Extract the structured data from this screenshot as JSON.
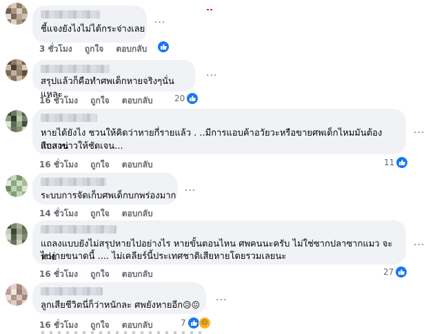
{
  "comments": [
    {
      "text": "ชี้แจงยังไงไม่ได้กระจ่างเลย",
      "time": "3 ชั่วโมง",
      "like": "ถูกใจ",
      "reply": "ตอบกลับ",
      "reaction_count": ""
    },
    {
      "text": "สรุปแล้วก็คือทำศพเด็กหายจริงๆนั่นแหละ",
      "time": "16 ชั่วโมง",
      "like": "ถูกใจ",
      "reply": "ตอบกลับ",
      "reaction_count": "20"
    },
    {
      "text_line1": "หายได้ยังไง ชวนให้คิดว่าหายกี่รายแล้ว . ..มีการแอบค้าอวัยวะหรือขายศพเด็กไหมมันต้องสืบสวน",
      "text_line2": "แถลงข่าวให้ชัดเจน...",
      "time": "16 ชั่วโมง",
      "like": "ถูกใจ",
      "reply": "ตอบกลับ",
      "reaction_count": "11"
    },
    {
      "text": "ระบบการจัดเก็บศพเด็กบกพร่องมาก",
      "time": "14 ชั่วโมง",
      "like": "ถูกใจ",
      "reply": "ตอบกลับ",
      "reaction_count": ""
    },
    {
      "text_line1": "แถลงแบบยังไม่สรุปหายไปอย่างไร หายขั้นตอนไหน ศพคนนะครับ ไม่ใช่ซากปลาซากแมว จะหาย",
      "text_line2": "ไปง่ายขนาดนี้ .... ไม่เคลียร์นี้ประเทศชาติเสียหายโดยรวมเลยนะ",
      "time": "16 ชั่วโมง",
      "like": "ถูกใจ",
      "reply": "ตอบกลับ",
      "reaction_count": "27"
    },
    {
      "text": "ลูกเสียชีวิตนี่ก็ว่าหนักละ ศพยังหายอีก",
      "text_emoji": "😥😖",
      "time": "16 ชั่วโมง",
      "like": "ถูกใจ",
      "reply": "ตอบกลับ",
      "reaction_count": "7"
    }
  ],
  "icons": {
    "more": "more-options-icon",
    "like": "like-reaction-icon",
    "sad": "sad-reaction-icon"
  },
  "colors": {
    "accent": "#1877f2",
    "bubble": "#f0f2f5",
    "meta": "#65676b"
  }
}
